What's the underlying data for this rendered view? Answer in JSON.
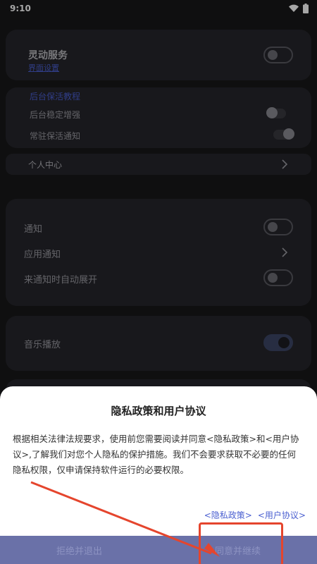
{
  "status_bar": {
    "time": "9:10"
  },
  "island_card": {
    "title": "灵动服务",
    "link": "界面设置"
  },
  "keepalive_card": {
    "header": "后台保活教程",
    "rows": [
      {
        "label": "后台稳定增强",
        "enabled": false
      },
      {
        "label": "常驻保活通知",
        "enabled": true
      }
    ]
  },
  "profile_row": {
    "label": "个人中心"
  },
  "notify_card": {
    "rows": [
      {
        "label": "通知",
        "control": "toggle",
        "enabled": false
      },
      {
        "label": "应用通知",
        "control": "chevron"
      },
      {
        "label": "来通知时自动展开",
        "control": "toggle",
        "enabled": false
      }
    ]
  },
  "music_card": {
    "label": "音乐播放",
    "enabled": true
  },
  "dialog": {
    "title": "隐私政策和用户协议",
    "body": "根据相关法律法规要求，使用前您需要阅读并同意<隐私政策>和<用户协议>,了解我们对您个人隐私的保护措施。我们不会要求获取不必要的任何隐私权限，仅申请保持软件运行的必要权限。",
    "privacy_link": "<隐私政策>",
    "terms_link": "<用户协议>",
    "reject_button": "拒绝并退出",
    "accept_button": "同意并继续"
  },
  "colors": {
    "background": "#17171a",
    "card": "#26262b",
    "link": "#4a5fd0",
    "button_bar": "#6a71a8",
    "annotation": "#e5452d"
  }
}
